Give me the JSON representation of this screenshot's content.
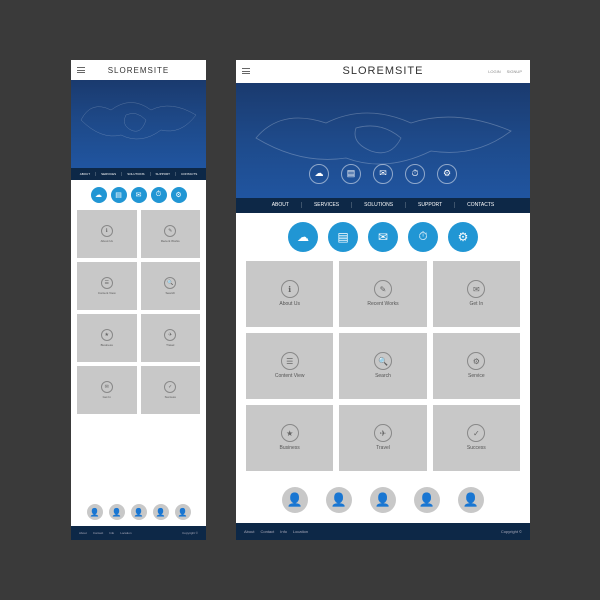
{
  "site_title": "SLOREMSITE",
  "top_links": [
    "LOGIN",
    "SIGNUP"
  ],
  "nav": [
    "ABOUT",
    "SERVICES",
    "SOLUTIONS",
    "SUPPORT",
    "CONTACTS"
  ],
  "hero_icons": [
    "☁",
    "▤",
    "✉",
    "⏱",
    "⚙"
  ],
  "features": [
    "☁",
    "▤",
    "✉",
    "⏱",
    "⚙"
  ],
  "tiles": [
    {
      "icon": "ℹ",
      "label": "About Us"
    },
    {
      "icon": "✎",
      "label": "Recent Works"
    },
    {
      "icon": "✉",
      "label": "Get In"
    },
    {
      "icon": "☰",
      "label": "Content View"
    },
    {
      "icon": "🔍",
      "label": "Search"
    },
    {
      "icon": "⚙",
      "label": "Service"
    },
    {
      "icon": "★",
      "label": "Business"
    },
    {
      "icon": "✈",
      "label": "Travel"
    },
    {
      "icon": "✓",
      "label": "Success"
    }
  ],
  "tiles_mobile": [
    {
      "icon": "ℹ",
      "label": "About Us"
    },
    {
      "icon": "✎",
      "label": "Recent Works"
    },
    {
      "icon": "☰",
      "label": "Content View"
    },
    {
      "icon": "🔍",
      "label": "Search"
    },
    {
      "icon": "★",
      "label": "Business"
    },
    {
      "icon": "✈",
      "label": "Travel"
    },
    {
      "icon": "✉",
      "label": "Get In"
    },
    {
      "icon": "✓",
      "label": "Success"
    }
  ],
  "avatars": 5,
  "footer_links": [
    "About",
    "Contact",
    "Info",
    "Location"
  ],
  "copyright": "Copyright ©"
}
